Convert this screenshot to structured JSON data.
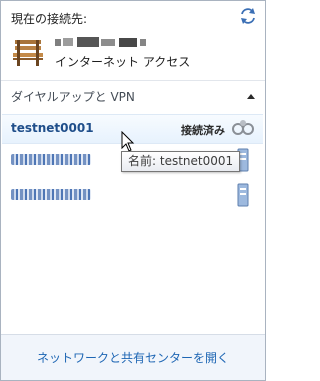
{
  "current": {
    "label": "現在の接続先:",
    "network_name": "",
    "status": "インターネット アクセス"
  },
  "section": {
    "title": "ダイヤルアップと VPN"
  },
  "connections": [
    {
      "name": "testnet0001",
      "status": "接続済み"
    },
    {
      "name": ""
    },
    {
      "name": ""
    }
  ],
  "tooltip": {
    "text": "名前: testnet0001"
  },
  "footer": {
    "link": "ネットワークと共有センターを開く"
  },
  "icons": {
    "refresh": "refresh-icon",
    "bench": "bench-icon",
    "collapse": "chevron-up-icon",
    "dialup": "dialup-connection-icon",
    "server": "server-icon",
    "cursor": "mouse-cursor-icon"
  },
  "colors": {
    "link": "#1e66b4",
    "network_name": "#1f4e8a",
    "selected_row": "#e7f2fd",
    "footer_bg": "#f1f5fb"
  }
}
